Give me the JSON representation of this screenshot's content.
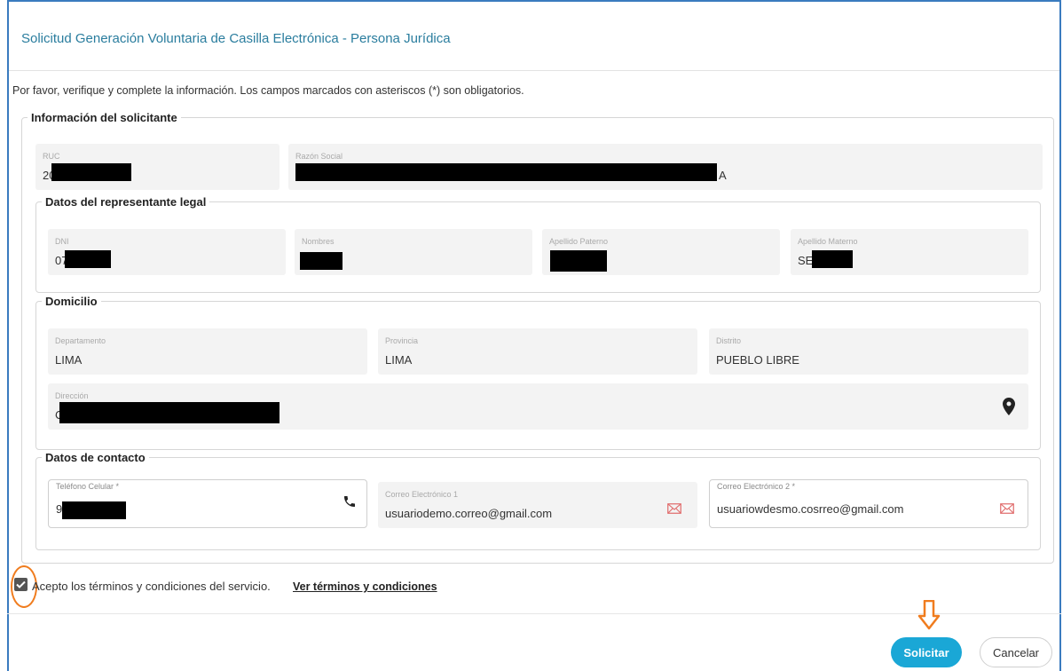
{
  "dialog": {
    "title": "Solicitud Generación Voluntaria de Casilla Electrónica - Persona Jurídica",
    "intro": "Por favor, verifique y complete la información. Los campos marcados con asteriscos (*) son obligatorios."
  },
  "solicitante": {
    "legend": "Información del solicitante",
    "ruc": {
      "label": "RUC",
      "value": "20"
    },
    "razon_social": {
      "label": "Razón Social",
      "value": "A"
    }
  },
  "representante": {
    "legend": "Datos del representante legal",
    "dni": {
      "label": "DNI",
      "value": "07"
    },
    "nombres": {
      "label": "Nombres",
      "value": ""
    },
    "apellido_paterno": {
      "label": "Apellido Paterno",
      "value": ""
    },
    "apellido_materno": {
      "label": "Apellido Materno",
      "value": "SE"
    }
  },
  "domicilio": {
    "legend": "Domicilio",
    "departamento": {
      "label": "Departamento",
      "value": "LIMA"
    },
    "provincia": {
      "label": "Provincia",
      "value": "LIMA"
    },
    "distrito": {
      "label": "Distrito",
      "value": "PUEBLO LIBRE"
    },
    "direccion": {
      "label": "Dirección",
      "value": "C"
    }
  },
  "contacto": {
    "legend": "Datos de contacto",
    "telefono": {
      "label": "Teléfono Celular *",
      "value": "9"
    },
    "correo1": {
      "label": "Correo Electrónico 1",
      "value": "usuariodemo.correo@gmail.com"
    },
    "correo2": {
      "label": "Correo Electrónico 2 *",
      "value": "usuariowdesmo.cosrreo@gmail.com"
    }
  },
  "terms": {
    "text": "Acepto los términos y condiciones del servicio.",
    "link": "Ver términos y condiciones",
    "checked": true
  },
  "actions": {
    "submit_label": "Solicitar",
    "cancel_label": "Cancelar"
  },
  "colors": {
    "title": "#2a7d9e",
    "primary": "#1aa7d6",
    "highlight": "#f07c1e",
    "frame": "#3a7bbf"
  },
  "icons": {
    "map": "map-pin-icon",
    "phone": "phone-icon",
    "mail": "mail-icon",
    "arrow": "arrow-down-icon",
    "check": "checkbox-checked-icon"
  }
}
